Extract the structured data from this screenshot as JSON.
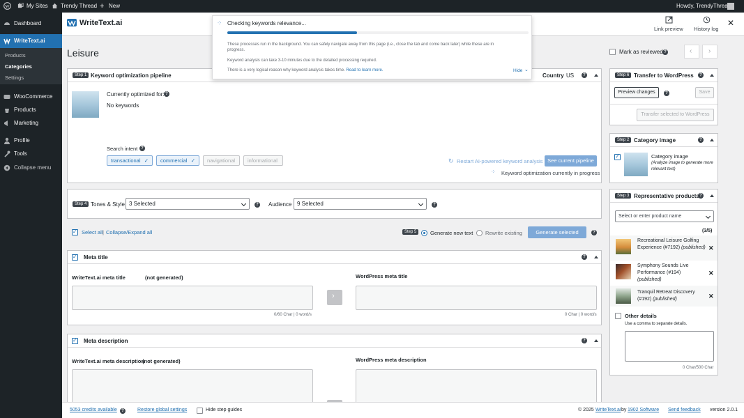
{
  "admin_bar": {
    "my_sites": "My Sites",
    "site_name": "Trendy Thread",
    "new": "New",
    "howdy": "Howdy, TrendyThread"
  },
  "sidebar": {
    "items": [
      {
        "label": "Dashboard",
        "icon": "dashboard-icon"
      },
      {
        "label": "WriteText.ai",
        "icon": "writetext-icon"
      },
      {
        "label": "WooCommerce",
        "icon": "woocommerce-icon"
      },
      {
        "label": "Products",
        "icon": "products-icon"
      },
      {
        "label": "Marketing",
        "icon": "marketing-icon"
      },
      {
        "label": "Profile",
        "icon": "profile-icon"
      },
      {
        "label": "Tools",
        "icon": "tools-icon"
      },
      {
        "label": "Collapse menu",
        "icon": "collapse-icon"
      }
    ],
    "submenu": [
      "Products",
      "Categories",
      "Settings"
    ]
  },
  "header": {
    "logo": "WriteText.ai",
    "link_preview": "Link preview",
    "history_log": "History log"
  },
  "page_title": "Leisure",
  "mark_as_reviewed": "Mark as reviewed",
  "popup": {
    "title": "Checking keywords relevance...",
    "progress": 0.43,
    "text1": "These processes run in the background. You can safely navigate away from this page (i.e., close the tab and come back later) while these are in progress.",
    "text2": "Keyword analysis can take 3-10 minutes due to the detailed processing required.",
    "text3": "There is a very logical reason why keyword analysis takes time.",
    "learn_more": "Read to learn more.",
    "hide": "Hide"
  },
  "step1": {
    "badge": "Step 1",
    "title": "Keyword optimization pipeline",
    "country_label": "Country",
    "country_value": "US",
    "currently_optimized": "Currently optimized for:",
    "no_keywords": "No keywords",
    "search_intent": "Search intent",
    "intents": [
      {
        "label": "transactional",
        "selected": true
      },
      {
        "label": "commercial",
        "selected": true
      },
      {
        "label": "navigational",
        "selected": false
      },
      {
        "label": "informational",
        "selected": false
      }
    ],
    "restart": "Restart AI-powered keyword analysis",
    "see_pipeline": "See current pipeline",
    "in_progress": "Keyword optimization currently in progress"
  },
  "step4": {
    "badge": "Step 4",
    "tones_label": "Tones & Style",
    "tones_value": "3 Selected",
    "audience_label": "Audience",
    "audience_value": "9 Selected"
  },
  "controls": {
    "select_all": "Select all",
    "collapse_expand": "Collapse/Expand all",
    "step5_badge": "Step 5",
    "generate_new": "Generate new text",
    "rewrite_existing": "Rewrite existing",
    "generate_selected": "Generate selected"
  },
  "meta_title": {
    "heading": "Meta title",
    "writetext_label": "WriteText.ai meta title",
    "not_generated": "(not generated)",
    "wp_label": "WordPress meta title",
    "left_count": "0/60 Char | 0 word/s",
    "right_count": "0 Char | 0 word/s"
  },
  "meta_description": {
    "heading": "Meta description",
    "writetext_label": "WriteText.ai meta description",
    "not_generated": "(not generated)",
    "wp_label": "WordPress meta description"
  },
  "step6": {
    "badge": "Step 6",
    "title": "Transfer to WordPress",
    "preview_changes": "Preview changes",
    "save": "Save",
    "transfer_selected": "Transfer selected to WordPress"
  },
  "step2": {
    "badge": "Step 2",
    "title": "Category image",
    "label": "Category image",
    "hint": "(Analyze image to generate more relevant text)"
  },
  "step3": {
    "badge": "Step 3",
    "title": "Representative products",
    "placeholder": "Select or enter product name",
    "count": "(3/5)",
    "products": [
      {
        "name": "Recreational Leisure Golfing Experience (#7192)",
        "status": "(published)"
      },
      {
        "name": "Symphony Sounds Live Performance (#194)",
        "status": "(published)"
      },
      {
        "name": "Tranquil Retreat Discovery (#192)",
        "status": "(published)"
      }
    ],
    "other_details": "Other details",
    "other_hint": "Use a comma to separate details.",
    "char_count": "0 Char/500 Char"
  },
  "footer": {
    "credits": "5053 credits available",
    "restore": "Restore global settings",
    "hide_guides": "Hide step guides",
    "copyright": "© 2025",
    "brand": "WriteText.ai",
    "by": "by",
    "company": "1902 Software",
    "feedback": "Send feedback",
    "version": "version 2.0.1"
  }
}
